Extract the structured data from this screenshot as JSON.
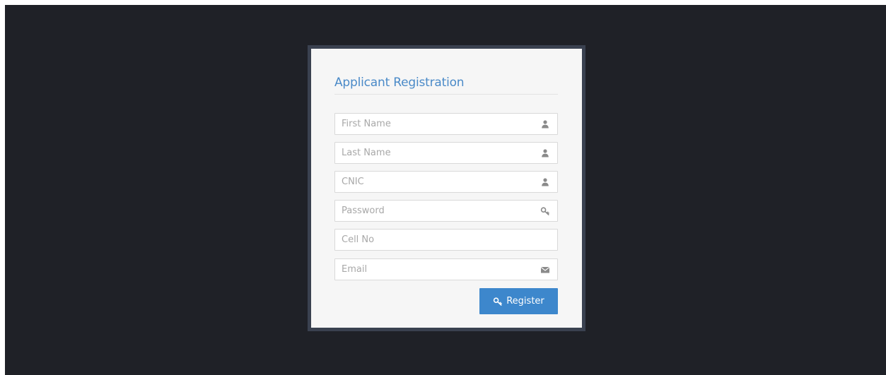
{
  "form": {
    "title": "Applicant Registration",
    "fields": [
      {
        "placeholder": "First Name",
        "value": "",
        "icon": "user-icon"
      },
      {
        "placeholder": "Last Name",
        "value": "",
        "icon": "user-icon"
      },
      {
        "placeholder": "CNIC",
        "value": "",
        "icon": "user-icon"
      },
      {
        "placeholder": "Password",
        "value": "",
        "icon": "key-icon"
      },
      {
        "placeholder": "Cell No",
        "value": "",
        "icon": ""
      },
      {
        "placeholder": "Email",
        "value": "",
        "icon": "envelope-icon"
      }
    ],
    "submit_label": "Register",
    "submit_icon": "key-icon"
  },
  "colors": {
    "background": "#1f2127",
    "frame": "#3a4150",
    "card": "#f6f6f6",
    "accent": "#3d87cc",
    "title": "#4a8ac8",
    "icon": "#8a8a8a"
  }
}
